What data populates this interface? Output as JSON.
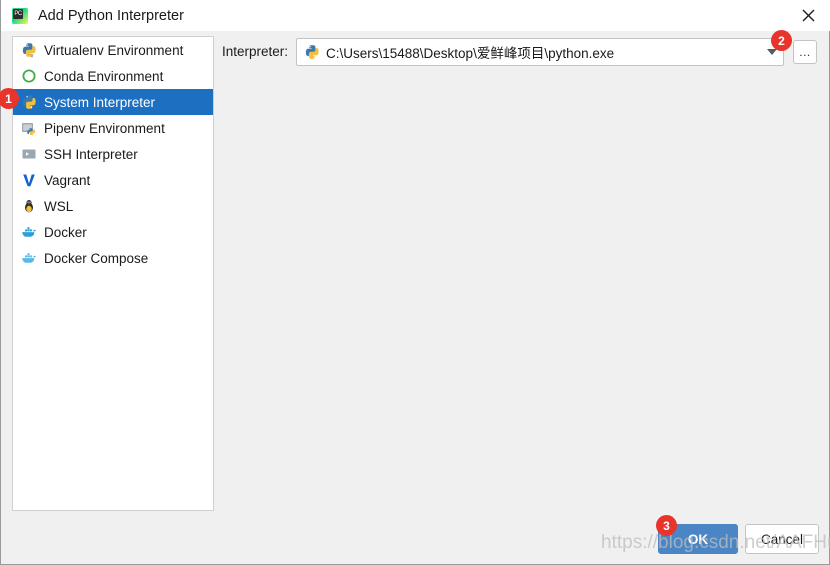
{
  "window": {
    "title": "Add Python Interpreter",
    "app_icon": "pycharm-icon",
    "close_icon": "close-icon"
  },
  "sidebar": {
    "items": [
      {
        "label": "Virtualenv Environment",
        "icon": "virtualenv-python-icon",
        "selected": false
      },
      {
        "label": "Conda Environment",
        "icon": "conda-circle-icon",
        "selected": false
      },
      {
        "label": "System Interpreter",
        "icon": "python-icon",
        "selected": true
      },
      {
        "label": "Pipenv Environment",
        "icon": "pipenv-icon",
        "selected": false
      },
      {
        "label": "SSH Interpreter",
        "icon": "ssh-terminal-icon",
        "selected": false
      },
      {
        "label": "Vagrant",
        "icon": "vagrant-icon",
        "selected": false
      },
      {
        "label": "WSL",
        "icon": "linux-penguin-icon",
        "selected": false
      },
      {
        "label": "Docker",
        "icon": "docker-whale-icon",
        "selected": false
      },
      {
        "label": "Docker Compose",
        "icon": "docker-compose-icon",
        "selected": false
      }
    ]
  },
  "main": {
    "interpreter_label": "Interpreter:",
    "interpreter_value": "C:\\Users\\15488\\Desktop\\爱鲜峰项目\\python.exe",
    "interpreter_icon": "python-icon",
    "dropdown_icon": "chevron-down-icon",
    "browse_label": "...",
    "browse_icon": "ellipsis-icon"
  },
  "buttons": {
    "ok_label": "OK",
    "cancel_label": "Cancel"
  },
  "annotations": {
    "badge_1": "1",
    "badge_2": "2",
    "badge_3": "3"
  },
  "watermark": {
    "text": "https://blog.csdn.net/AAFHudong"
  },
  "colors": {
    "accent": "#1d6fc2",
    "ok_button": "#4a86c5",
    "badge": "#e8342a",
    "dialog_bg": "#f0f0f0"
  }
}
